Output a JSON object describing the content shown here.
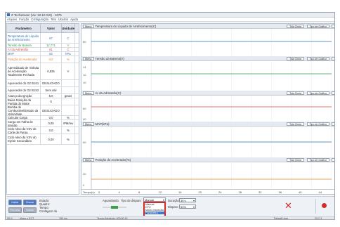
{
  "window": {
    "title": "Z Techstream (Ver 18.10.018) - 1676"
  },
  "menu": [
    "Arquivo",
    "Função",
    "Configuração",
    "Tela",
    "Usuário",
    "Ajuda"
  ],
  "table": {
    "headers": [
      "Parâmetro",
      "Valor",
      "Unidade"
    ],
    "rows": [
      {
        "name": "Temperatura do Líquido de Arrefecimento",
        "value": "67",
        "unit": "C"
      },
      {
        "name": "Tensão da Bateria",
        "value": "12,771",
        "unit": "V"
      },
      {
        "name": "Ar da Admissão",
        "value": "61",
        "unit": "C"
      },
      {
        "name": "MAP",
        "value": "52",
        "unit": "kPa"
      },
      {
        "name": "Posição do Acelerador",
        "value": "0,0",
        "unit": "%"
      },
      {
        "name": "Aprendizado de Válvula de Aceleração Totalmente Fechada",
        "value": "0,625",
        "unit": "V"
      },
      {
        "name": "Aquecedor do O2 B1S1",
        "value": "DESLIGADO",
        "unit": ""
      },
      {
        "name": "Aquecedor do O2 B1S2",
        "value": "Sem ativ",
        "unit": ""
      },
      {
        "name": "Avanço da Ignição",
        "value": "5,0",
        "unit": "graus"
      },
      {
        "name": "Baixa Rotação da Partida do Motor",
        "value": "0",
        "unit": ""
      },
      {
        "name": "Bomba de Combustível/Estado da Velocidade",
        "value": "DESLIGADO",
        "unit": ""
      },
      {
        "name": "Calcular Carga",
        "value": "0,0",
        "unit": "%"
      },
      {
        "name": "Carga em Falha de Ignição",
        "value": "0,00",
        "unit": "rPM/rev"
      },
      {
        "name": "Ciclo Ativo da VSV de Corte de Purga",
        "value": "0,0",
        "unit": "%"
      },
      {
        "name": "Ciclo Ativo da VSV do Injetor Secundário",
        "value": "0,00",
        "unit": "%"
      }
    ]
  },
  "panels": [
    {
      "title": "Temperatura do Líquido de Arrefecimento(C)",
      "ticks": [
        "80"
      ],
      "color": "#2f6db5"
    },
    {
      "title": "Tensão da Bateria(V)",
      "ticks": [
        "14",
        "12",
        "10"
      ],
      "color": "#2c9a4a"
    },
    {
      "title": "Ar da Admissão(C)",
      "ticks": [
        "60",
        "40"
      ],
      "color": "#d6452f"
    },
    {
      "title": "MAP(kPa)",
      "ticks": [
        "50"
      ],
      "color": "#2f6db5"
    },
    {
      "title": "Posição do Acelerador(%)",
      "ticks": [
        "20",
        "0"
      ],
      "color": "#e0812a"
    }
  ],
  "panel_labels": {
    "menu": "Menu",
    "wave": "Tela Cheia",
    "graph": "Tipo de Gráfico"
  },
  "xaxis": {
    "label": "Tempo(s)",
    "ticks": [
      "0",
      "4",
      "8",
      "12",
      "16",
      "20",
      "24",
      "28",
      "32",
      "36",
      "40",
      "44",
      "48"
    ]
  },
  "bottom": {
    "btn_start": "Iniciar",
    "btn_stop": "Gravar",
    "btn_pre": "Pre-sinc",
    "btn_prog": "Gravar",
    "state_lbl": "Estado:",
    "frames_lbl": "Quadro:",
    "time_lbl": "Tempo:",
    "count_lbl": "Contagem do",
    "waiting": "Aguardando",
    "trigger_lbl": "Tipo de disparo",
    "trigger_value": "Manual",
    "dropdown": [
      "Manual",
      "DTC",
      "Modo Inspeção de DTC",
      "Parâmetro"
    ],
    "duration_lbl": "Duração",
    "duration_value": "30 s",
    "trigger_pos_lbl": "Disparo",
    "trigger_pos_value": "50%"
  },
  "status": {
    "code": "S0-0",
    "car": "Motor e ECT",
    "rate": "780 ms",
    "sampling": "Tempo Medindo: 000:00:15",
    "user": "Default User",
    "net": "DLC 3"
  }
}
